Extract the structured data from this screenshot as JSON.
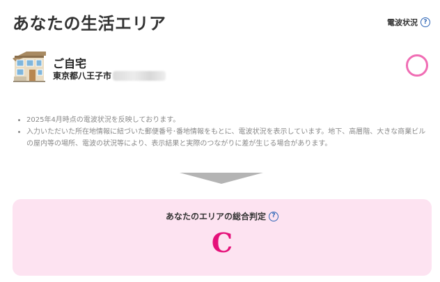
{
  "header": {
    "title": "あなたの生活エリア",
    "signal_status_label": "電波状況",
    "help_symbol": "?"
  },
  "home": {
    "name": "ご自宅",
    "address_prefix": "東京都八王子市",
    "status_mark": "circle",
    "status_color": "#f06db4"
  },
  "notes": [
    "2025年4月時点の電波状況を反映しております。",
    "入力いただいた所在地情報に紐づいた郵便番号･番地情報をもとに、電波状況を表示しています。地下、高層階、大きな商業ビルの屋内等の場所、電波の状況等により、表示結果と実際のつながりに差が生じる場合があります。"
  ],
  "judgement": {
    "title": "あなたのエリアの総合判定",
    "help_symbol": "?",
    "grade": "C",
    "grade_color": "#e5117a",
    "card_color": "#fde3f1"
  }
}
